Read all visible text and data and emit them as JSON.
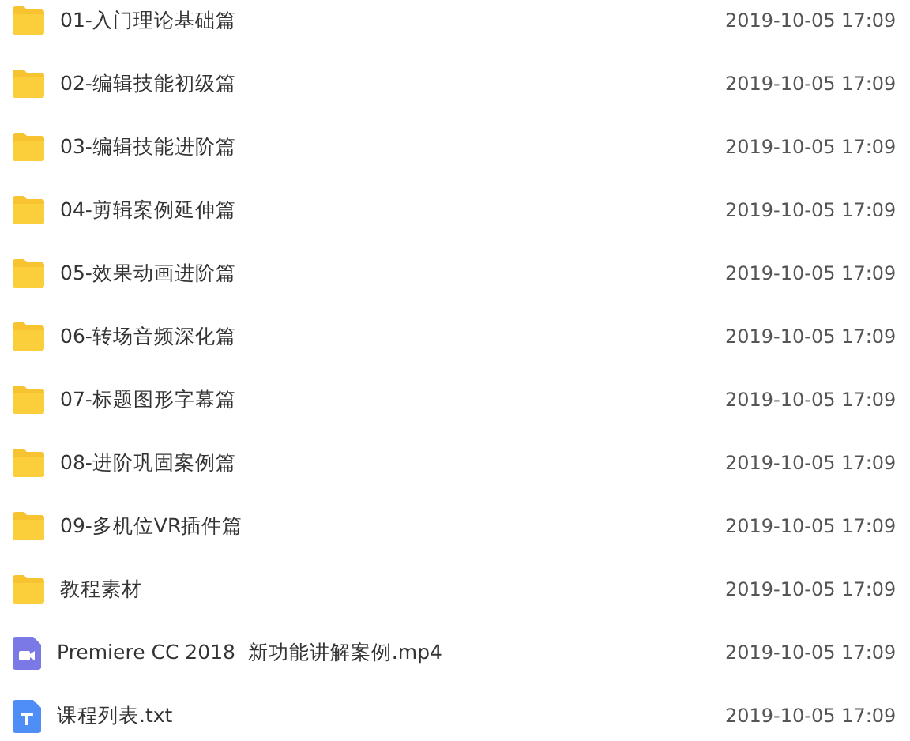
{
  "files": [
    {
      "kind": "folder",
      "name": "01-入门理论基础篇",
      "modified": "2019-10-05 17:09"
    },
    {
      "kind": "folder",
      "name": "02-编辑技能初级篇",
      "modified": "2019-10-05 17:09"
    },
    {
      "kind": "folder",
      "name": "03-编辑技能进阶篇",
      "modified": "2019-10-05 17:09"
    },
    {
      "kind": "folder",
      "name": "04-剪辑案例延伸篇",
      "modified": "2019-10-05 17:09"
    },
    {
      "kind": "folder",
      "name": "05-效果动画进阶篇",
      "modified": "2019-10-05 17:09"
    },
    {
      "kind": "folder",
      "name": "06-转场音频深化篇",
      "modified": "2019-10-05 17:09"
    },
    {
      "kind": "folder",
      "name": "07-标题图形字幕篇",
      "modified": "2019-10-05 17:09"
    },
    {
      "kind": "folder",
      "name": "08-进阶巩固案例篇",
      "modified": "2019-10-05 17:09"
    },
    {
      "kind": "folder",
      "name": "09-多机位VR插件篇",
      "modified": "2019-10-05 17:09"
    },
    {
      "kind": "folder",
      "name": "教程素材",
      "modified": "2019-10-05 17:09"
    },
    {
      "kind": "video",
      "name": "Premiere CC 2018  新功能讲解案例.mp4",
      "modified": "2019-10-05 17:09"
    },
    {
      "kind": "text",
      "name": "课程列表.txt",
      "modified": "2019-10-05 17:09"
    }
  ]
}
